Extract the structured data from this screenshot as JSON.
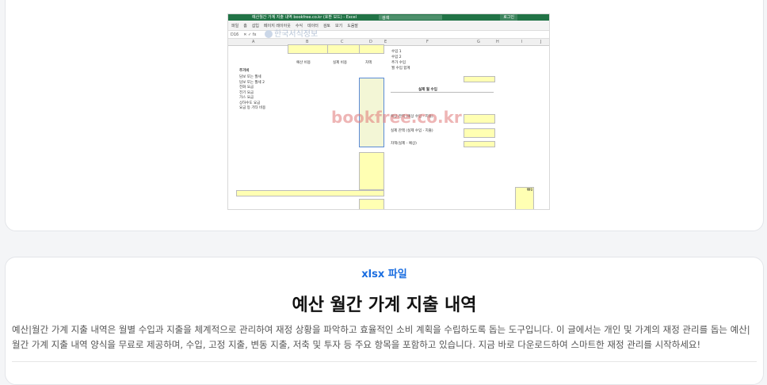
{
  "preview": {
    "window_title": "예산월간 가계 지출 내역 bookfree.co.kr  (호환 모드) - Excel",
    "search_label": "검색",
    "login_label": "로그인",
    "ribbon_tabs": [
      "파일",
      "홈",
      "삽입",
      "페이지 레이아웃",
      "수식",
      "데이터",
      "검토",
      "보기",
      "도움말"
    ],
    "name_box": "D16",
    "columns": [
      "A",
      "B",
      "C",
      "D",
      "E",
      "F",
      "G",
      "H",
      "I",
      "J"
    ],
    "header_budget": "예산 비용",
    "header_actual": "실제 비용",
    "header_diff": "차액",
    "left_section": "주거비",
    "left_rows": [
      "담보 또는 월세",
      "담보 또는 월세 2",
      "전화 요금",
      "전기 요금",
      "가스 요금",
      "상하수도 요금",
      "요금 등 기타 비용"
    ],
    "right_rows": [
      "수입 1",
      "수입 2",
      "추가 수입",
      "월 수입 합계"
    ],
    "actual_income_header": "실제 월 수입",
    "balance_labels": [
      "예상 잔액 (예상 수입 - 지출)",
      "실제 잔액 (실제 수입 - 지출)",
      "차액(실제 - 예상)"
    ],
    "diff_value": "₩0",
    "watermark": "bookfree.co.kr",
    "logo_text": "한국서식정보"
  },
  "file_type": "xlsx 파일",
  "title": "예산 월간 가계 지출 내역",
  "description": "예산|월간 가계 지출 내역은 월별 수입과 지출을 체계적으로 관리하여 재정 상황을 파악하고 효율적인 소비 계획을 수립하도록 돕는 도구입니다. 이 글에서는 개인 및 가계의 재정 관리를 돕는 예산|월간 가계 지출 내역 양식을 무료로 제공하며, 수입, 고정 지출, 변동 지출, 저축 및 투자 등 주요 항목을 포함하고 있습니다. 지금 바로 다운로드하여 스마트한 재정 관리를 시작하세요!"
}
